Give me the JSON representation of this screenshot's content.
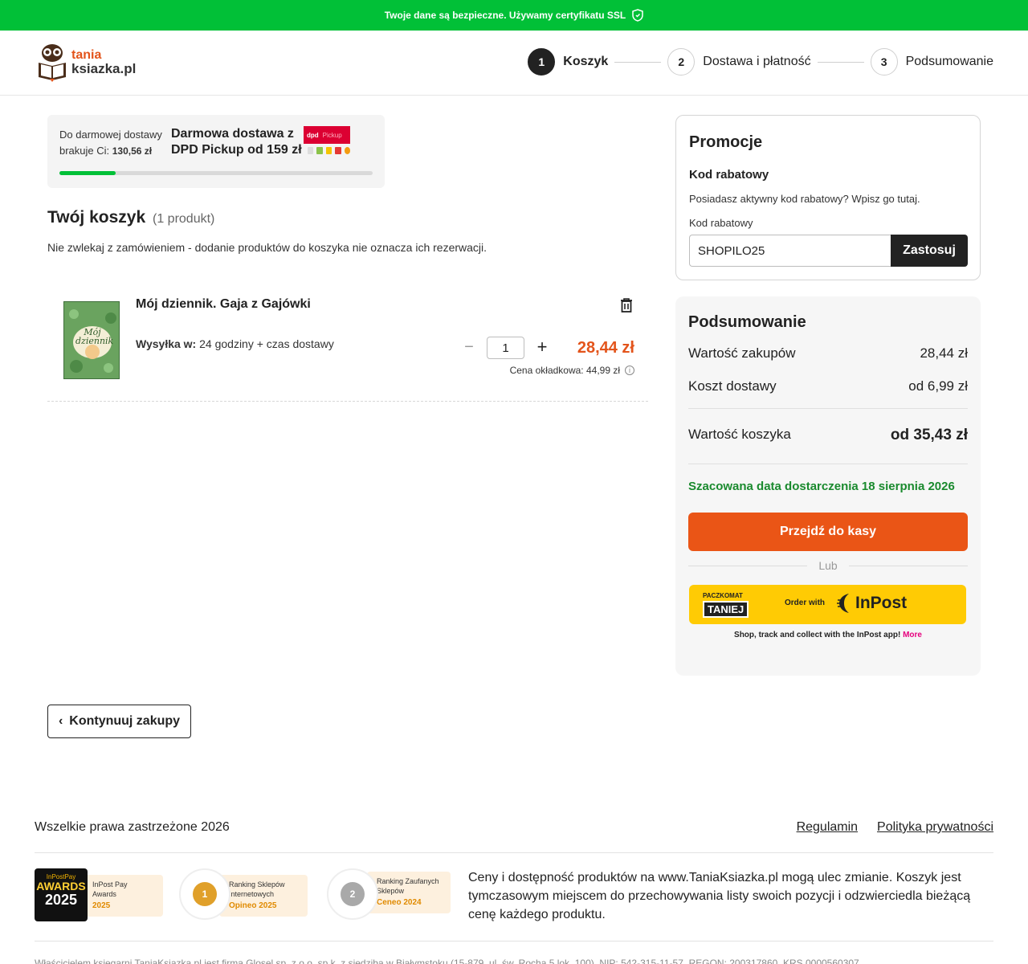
{
  "ssl_bar": {
    "text": "Twoje dane są bezpieczne. Używamy certyfikatu SSL",
    "bg": "#01c037"
  },
  "logo": {
    "line1": "tania",
    "line2": "ksiazka.pl"
  },
  "steps": [
    {
      "num": "1",
      "label": "Koszyk",
      "active": true
    },
    {
      "num": "2",
      "label": "Dostawa i płatność",
      "active": false
    },
    {
      "num": "3",
      "label": "Podsumowanie",
      "active": false
    }
  ],
  "free_shipping": {
    "line1": "Do darmowej dostawy",
    "line2_prefix": "brakuje Ci: ",
    "missing_amount": "130,56 zł",
    "promo_line1": "Darmowa dostawa z",
    "promo_line2": "DPD Pickup od 159 zł",
    "progress_fraction": 0.18,
    "dpd_label": "dpd",
    "pickup_label": "Pickup"
  },
  "cart": {
    "title": "Twój koszyk",
    "count": "(1 produkt)",
    "note": "Nie zwlekaj z zamówieniem - dodanie produktów do koszyka nie oznacza ich rezerwacji."
  },
  "product": {
    "name": "Mój dziennik. Gaja z Gajówki",
    "ship_label": "Wysyłka w:",
    "ship_value": " 24 godziny + czas dostawy",
    "quantity": "1",
    "price": "28,44 zł",
    "cover_price": "Cena okładkowa: 44,99 zł",
    "cover_text_line1": "Mój",
    "cover_text_line2": "dziennik"
  },
  "continue_button": "Kontynuuj zakupy",
  "promo": {
    "title": "Promocje",
    "subtitle": "Kod rabatowy",
    "description": "Posiadasz aktywny kod rabatowy? Wpisz go tutaj.",
    "field_label": "Kod rabatowy",
    "code_value": "SHOPILO25",
    "apply_label": "Zastosuj"
  },
  "summary": {
    "title": "Podsumowanie",
    "purchase_label": "Wartość zakupów",
    "purchase_value": "28,44 zł",
    "delivery_label": "Koszt dostawy",
    "delivery_value": "od 6,99 zł",
    "total_label": "Wartość koszyka",
    "total_value": "od 35,43 zł",
    "delivery_date": "Szacowana data dostarczenia 18 sierpnia 2026",
    "checkout_label": "Przejdź do kasy",
    "or_label": "Lub",
    "inpost_badge_top": "PACZKOMAT",
    "inpost_badge_main": "TANIEJ",
    "inpost_order_with": "Order with",
    "inpost_brand": "InPost",
    "inpost_note": "Shop, track and collect with the InPost app! ",
    "inpost_more": "More"
  },
  "footer": {
    "copyright": "Wszelkie prawa zastrzeżone 2026",
    "link_terms": "Regulamin",
    "link_privacy": "Polityka prywatności",
    "awards": [
      {
        "title_line1": "InPost Pay",
        "title_line2": "Awards",
        "year": "2025",
        "badge_top": "InPostPay",
        "badge_main": "AWARDS",
        "badge_year": "2025"
      },
      {
        "title_line1": "Ranking Sklepów",
        "title_line2": "Internetowych",
        "year": "Opineo 2025",
        "medal": "1"
      },
      {
        "title_line1": "Ranking Zaufanych",
        "title_line2": "Sklepów",
        "year": "Ceneo 2024",
        "medal": "2"
      }
    ],
    "description": "Ceny i dostępność produktów na www.TaniaKsiazka.pl mogą ulec zmianie. Koszyk jest tymczasowym miejscem do przechowywania listy swoich pozycji i odzwierciedla bieżącą cenę każdego produktu.",
    "legal": "Właścicielem księgarni TaniaKsiazka.pl jest firma Glosel sp. z o.o. sp.k. z siedzibą w Białymstoku (15-879, ul. św. Rocha 5 lok. 100), NIP: 542-315-11-57, REGON: 200317860, KRS 0000560307"
  }
}
